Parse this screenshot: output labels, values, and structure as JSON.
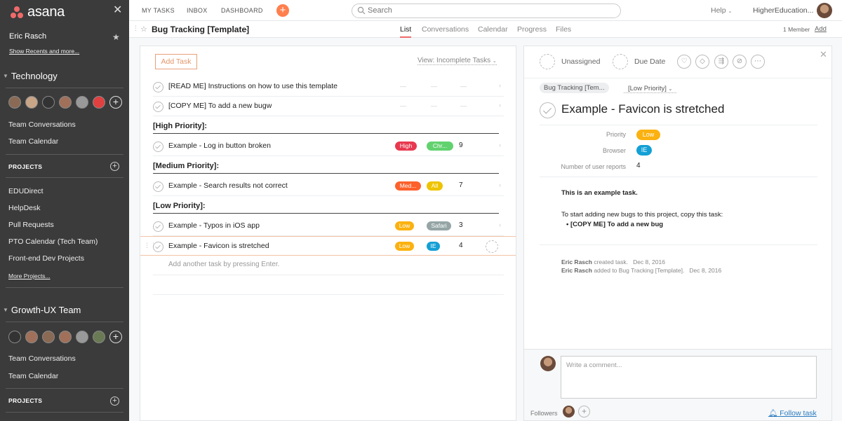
{
  "colors": {
    "brand": "#f06a6a",
    "high": "#e8384f",
    "medium": "#fd612c",
    "low": "#fbb10f",
    "chrome": "#62d26f",
    "all": "#eec300",
    "safari": "#95a5a6",
    "ie": "#13a0d5",
    "addtask": "#e4966a",
    "link": "#2a7bbf"
  },
  "sidebar": {
    "logo": "asana",
    "user": "Eric Rasch",
    "show_recents": "Show Recents and more...",
    "teams": [
      {
        "name": "Technology",
        "conversations": "Team Conversations",
        "calendar": "Team Calendar",
        "projects_head": "PROJECTS",
        "projects": [
          "EDUDirect",
          "HelpDesk",
          "Pull Requests",
          "PTO Calendar (Tech Team)",
          "Front-end Dev Projects"
        ],
        "more": "More Projects..."
      },
      {
        "name": "Growth-UX Team",
        "conversations": "Team Conversations",
        "calendar": "Team Calendar",
        "projects_head": "PROJECTS"
      }
    ]
  },
  "topbar": {
    "my_tasks": "MY TASKS",
    "inbox": "INBOX",
    "dashboard": "DASHBOARD",
    "search_placeholder": "Search",
    "help": "Help",
    "org": "HigherEducation..."
  },
  "project": {
    "title": "Bug Tracking [Template]",
    "tabs": [
      "List",
      "Conversations",
      "Calendar",
      "Progress",
      "Files"
    ],
    "active_tab": "List",
    "members": "1 Member",
    "add": "Add"
  },
  "list": {
    "add_task": "Add Task",
    "view": "View: Incomplete Tasks",
    "add_another": "Add another task by pressing Enter.",
    "placeholder_dash": "—",
    "instructions": [
      "[READ ME] Instructions on how to use this template",
      "[COPY ME] To add a new bugw"
    ],
    "sections": [
      {
        "title": "[High Priority]:",
        "tasks": [
          {
            "name": "Example - Log in button broken",
            "priority": "High",
            "browser": "Chr...",
            "reports": "9"
          }
        ]
      },
      {
        "title": "[Medium Priority]:",
        "tasks": [
          {
            "name": "Example -  Search results not correct",
            "priority": "Med...",
            "browser": "All",
            "reports": "7"
          }
        ]
      },
      {
        "title": "[Low Priority]:",
        "tasks": [
          {
            "name": "Example - Typos in iOS app",
            "priority": "Low",
            "browser": "Safari",
            "reports": "3"
          },
          {
            "name": "Example - Favicon is stretched",
            "priority": "Low",
            "browser": "IE",
            "reports": "4"
          }
        ]
      }
    ]
  },
  "detail": {
    "assignee": "Unassigned",
    "due": "Due Date",
    "project_pill": "Bug Tracking [Tem...",
    "section_pill": "[Low Priority]",
    "title": "Example - Favicon is stretched",
    "fields": [
      {
        "label": "Priority",
        "value": "Low"
      },
      {
        "label": "Browser",
        "value": "IE"
      },
      {
        "label": "Number of user reports",
        "value": "4"
      }
    ],
    "description": {
      "line1": "This is an example task.",
      "line2": "To start adding new bugs to this project, copy this task:",
      "bullet": "[COPY ME] To add a new bug"
    },
    "activity": [
      {
        "who": "Eric Rasch",
        "what": " created task.",
        "when": "Dec 8, 2016"
      },
      {
        "who": "Eric Rasch",
        "what": " added to Bug Tracking [Template].",
        "when": "Dec 8, 2016"
      }
    ],
    "comment_placeholder": "Write a comment...",
    "followers": "Followers",
    "follow": "Follow task"
  }
}
